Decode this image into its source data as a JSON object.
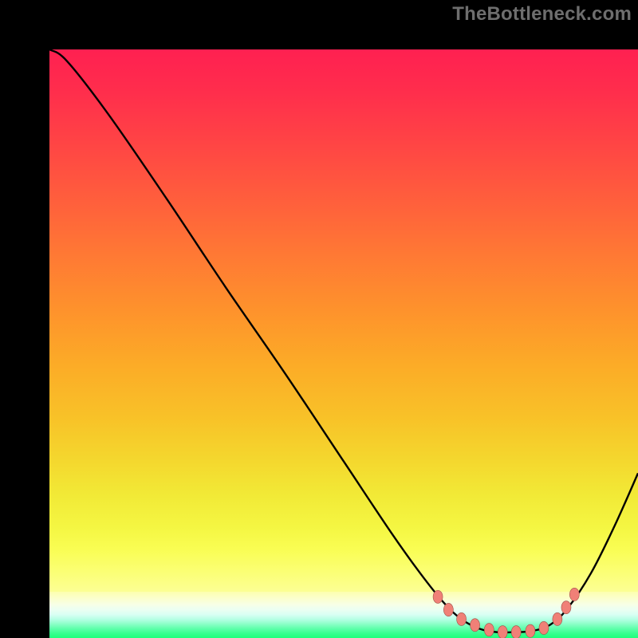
{
  "watermark": "TheBottleneck.com",
  "colors": {
    "frame": "#000000",
    "curve_stroke": "#000000",
    "marker_fill": "#f08077",
    "marker_stroke": "#a05048",
    "gradient_top_to_bottom": [
      "#ff2051",
      "#ff2e4c",
      "#ff4644",
      "#ff5f3c",
      "#ff7934",
      "#fe922c",
      "#fcab27",
      "#f8c228",
      "#f4d82e",
      "#f2e936",
      "#f4f642",
      "#f9fd52",
      "#fbff72",
      "#fcff94"
    ],
    "gradient_base_to_green": [
      "#fdffaf",
      "#fbffce",
      "#f7ffe5",
      "#ecfff2",
      "#d7fff3",
      "#b4ffe3",
      "#8affc7",
      "#5dffaa",
      "#37ff8f",
      "#1eff7a"
    ]
  },
  "chart_data": {
    "type": "line",
    "title": "",
    "xlabel": "",
    "ylabel": "",
    "xlim": [
      0,
      100
    ],
    "ylim": [
      0,
      100
    ],
    "curve": [
      {
        "x": 0,
        "y": 100
      },
      {
        "x": 3,
        "y": 98
      },
      {
        "x": 10,
        "y": 89
      },
      {
        "x": 20,
        "y": 74.5
      },
      {
        "x": 30,
        "y": 59.5
      },
      {
        "x": 40,
        "y": 45
      },
      {
        "x": 50,
        "y": 30
      },
      {
        "x": 58,
        "y": 18
      },
      {
        "x": 63,
        "y": 11
      },
      {
        "x": 67,
        "y": 6
      },
      {
        "x": 70,
        "y": 3.2
      },
      {
        "x": 73,
        "y": 1.6
      },
      {
        "x": 76,
        "y": 1.0
      },
      {
        "x": 79,
        "y": 1.0
      },
      {
        "x": 82,
        "y": 1.2
      },
      {
        "x": 85,
        "y": 2.2
      },
      {
        "x": 88,
        "y": 5
      },
      {
        "x": 92,
        "y": 11
      },
      {
        "x": 96,
        "y": 19
      },
      {
        "x": 100,
        "y": 28
      }
    ],
    "markers": [
      {
        "x": 66.0,
        "y": 7.0
      },
      {
        "x": 67.8,
        "y": 4.8
      },
      {
        "x": 70.0,
        "y": 3.2
      },
      {
        "x": 72.3,
        "y": 2.2
      },
      {
        "x": 74.7,
        "y": 1.4
      },
      {
        "x": 77.0,
        "y": 1.0
      },
      {
        "x": 79.3,
        "y": 1.0
      },
      {
        "x": 81.7,
        "y": 1.2
      },
      {
        "x": 84.0,
        "y": 1.7
      },
      {
        "x": 86.3,
        "y": 3.2
      },
      {
        "x": 87.8,
        "y": 5.2
      },
      {
        "x": 89.2,
        "y": 7.4
      }
    ],
    "marker_radius_px": 6
  }
}
